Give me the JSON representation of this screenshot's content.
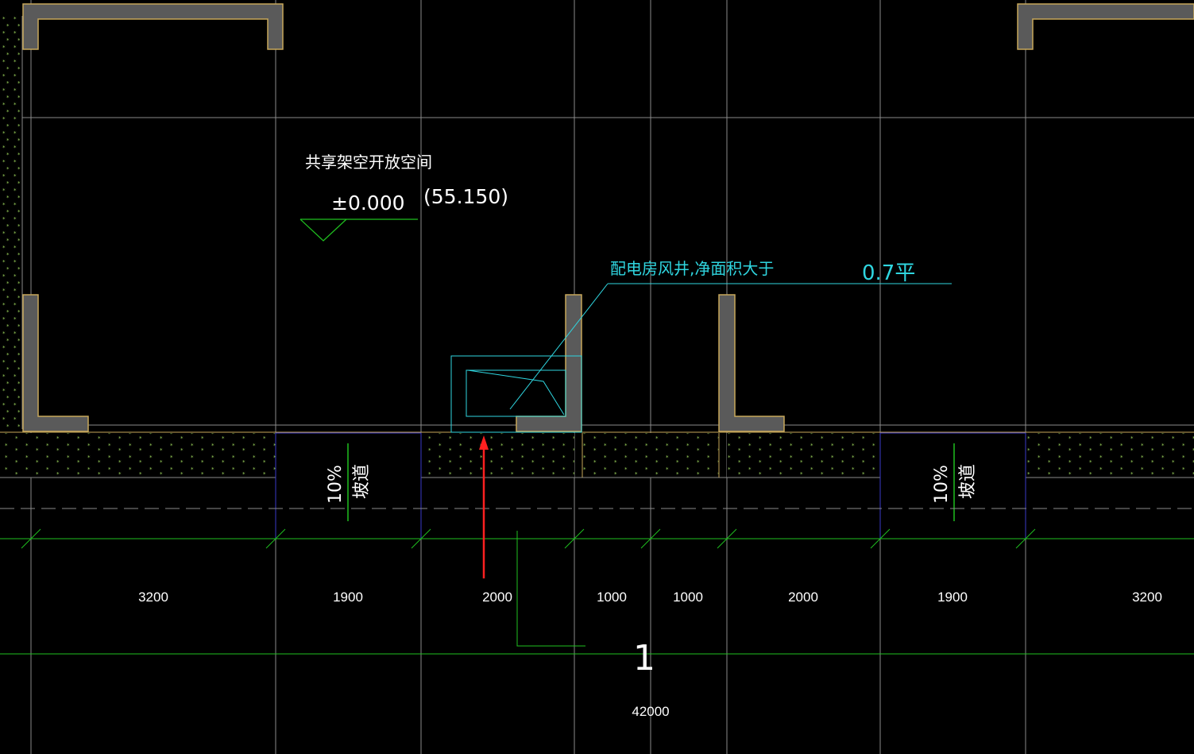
{
  "colors": {
    "background": "#000000",
    "grid": "#8a8a8a",
    "wall_fill": "#5a5a5a",
    "wall_edge": "#c8a85a",
    "hatch": "#1f6f1f",
    "hatch_dot": "#9ad35a",
    "green_line": "#1fbf1f",
    "cyan": "#2fd6e0",
    "blue_line": "#3a3ac8",
    "arrow": "#ff2020",
    "text": "#ffffff"
  },
  "labels": {
    "space_name": "共享架空开放空间",
    "elevation": "±0.000",
    "elevation_abs": "(55.150)",
    "shaft_note": "配电房风井,净面积大于",
    "shaft_area": "0.7平",
    "ramp_left_pct": "10%",
    "ramp_left_word": "坡道",
    "ramp_right_pct": "10%",
    "ramp_right_word": "坡道",
    "section_mark": "1",
    "total_dim": "42000"
  },
  "dimensions": [
    "3200",
    "1900",
    "2000",
    "1000",
    "1000",
    "2000",
    "1900",
    "3200"
  ],
  "icons": {
    "elevation_marker": "triangle-elevation-icon",
    "red_arrow": "arrow-up-icon"
  }
}
